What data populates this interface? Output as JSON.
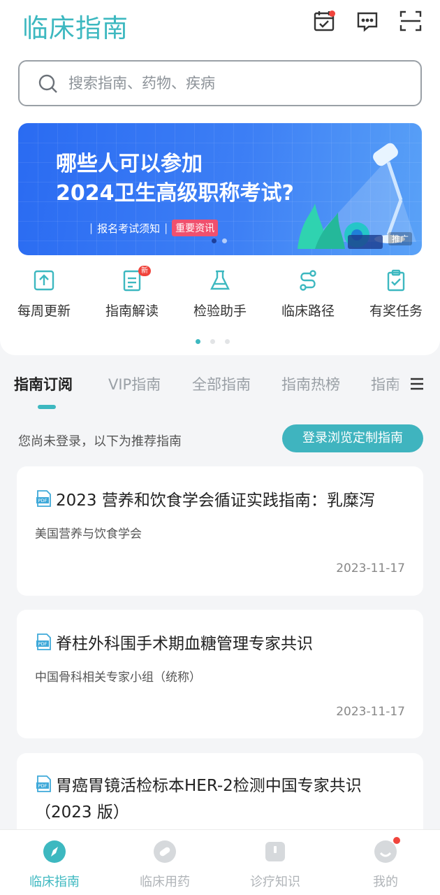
{
  "app": {
    "logo_text": "临床指南"
  },
  "search": {
    "placeholder": "搜索指南、药物、疾病"
  },
  "banner": {
    "line1": "哪些人可以参加",
    "line2": "2024卫生高级职称考试?",
    "subtitle": "报名考试须知",
    "tag": "重要资讯",
    "ad_label": "推广"
  },
  "quick_actions": [
    {
      "label": "每周更新",
      "icon": "upload-icon"
    },
    {
      "label": "指南解读",
      "icon": "document-icon",
      "badge": "新"
    },
    {
      "label": "检验助手",
      "icon": "flask-icon"
    },
    {
      "label": "临床路径",
      "icon": "route-icon"
    },
    {
      "label": "有奖任务",
      "icon": "clipboard-check-icon"
    }
  ],
  "tabs": [
    {
      "label": "指南订阅",
      "active": true
    },
    {
      "label": "VIP指南"
    },
    {
      "label": "全部指南"
    },
    {
      "label": "指南热榜"
    },
    {
      "label": "指南"
    }
  ],
  "notice": {
    "text": "您尚未登录，以下为推荐指南",
    "login_button": "登录浏览定制指南"
  },
  "guidelines": [
    {
      "title": "2023 营养和饮食学会循证实践指南：乳糜泻",
      "source": "美国营养与饮食学会",
      "date": "2023-11-17"
    },
    {
      "title": "脊柱外科围手术期血糖管理专家共识",
      "source": "中国骨科相关专家小组（统称）",
      "date": "2023-11-17"
    },
    {
      "title": "胃癌胃镜活检标本HER-2检测中国专家共识（2023 版）",
      "source": "",
      "date": ""
    }
  ],
  "bottom_nav": [
    {
      "label": "临床指南",
      "active": true
    },
    {
      "label": "临床用药"
    },
    {
      "label": "诊疗知识"
    },
    {
      "label": "我的"
    }
  ],
  "colors": {
    "accent": "#3db8c0",
    "banner_blue": "#2a6bf2",
    "alert_red": "#f0443c"
  }
}
